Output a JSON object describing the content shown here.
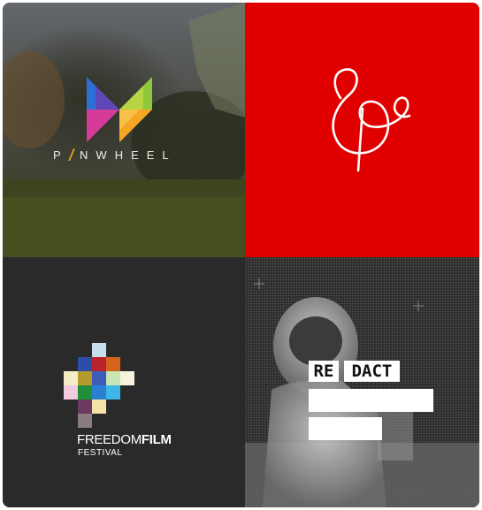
{
  "pinwheel": {
    "word": "P NWHEEL",
    "colors": [
      "#2f6fd8",
      "#8fc83a",
      "#d63b9a",
      "#f5a623",
      "#6a3fb2"
    ]
  },
  "ampersand": {
    "background": "#e10000",
    "glyph_color": "#ffffff"
  },
  "freedom_film": {
    "word_regular": "FREEDOM",
    "word_bold": "FILM",
    "subtitle": "FESTIVAL"
  },
  "redact": {
    "word_left": "RE",
    "word_right": "DACT"
  }
}
